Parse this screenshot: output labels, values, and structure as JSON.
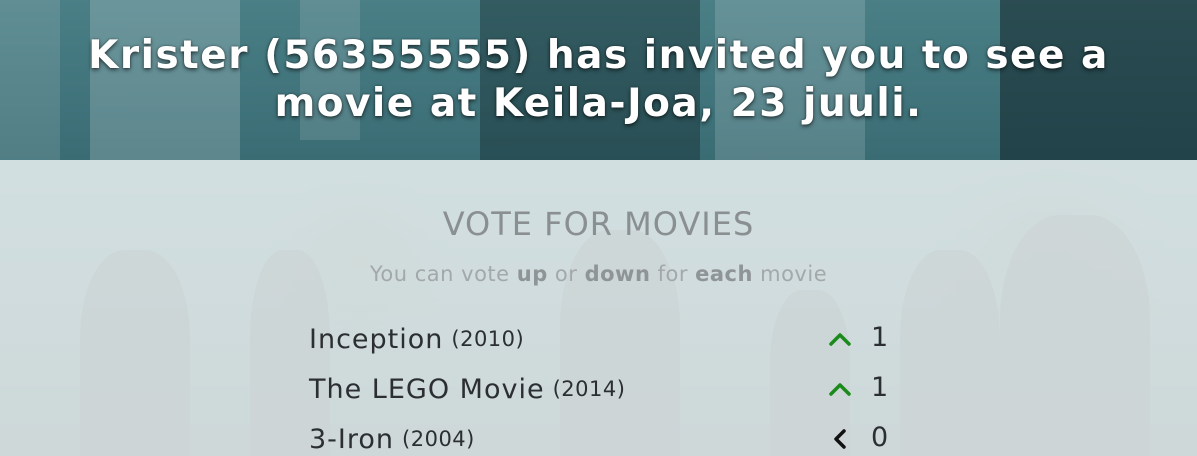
{
  "header": {
    "invite_text": "Krister (56355555) has invited you to see a movie at Keila-Joa, 23 juuli."
  },
  "vote": {
    "title": "VOTE FOR MOVIES",
    "subtitle": {
      "part1": "You can vote ",
      "up": "up",
      "part2": " or ",
      "down": "down",
      "part3": " for ",
      "each": "each",
      "part4": " movie"
    }
  },
  "movies": [
    {
      "title": "Inception",
      "year": "(2010)",
      "votes": "1",
      "vote_state": "up",
      "vote_icon": "chevron-up-icon"
    },
    {
      "title": "The LEGO Movie",
      "year": "(2014)",
      "votes": "1",
      "vote_state": "up",
      "vote_icon": "chevron-up-icon"
    },
    {
      "title": "3-Iron",
      "year": "(2004)",
      "votes": "0",
      "vote_state": "none",
      "vote_icon": "chevron-left-icon"
    }
  ],
  "colors": {
    "vote_up": "#1a8a1a",
    "vote_neutral": "#111111",
    "header_text": "#ffffff"
  }
}
